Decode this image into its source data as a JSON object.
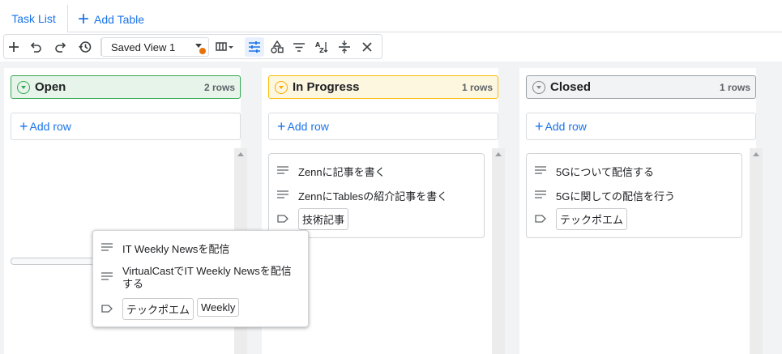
{
  "tabs": {
    "active": "Task List",
    "add": "Add Table"
  },
  "toolbar": {
    "view": "Saved View 1",
    "accent": "#1a73e8",
    "dot_color": "#e8710a",
    "icons": [
      "plus-icon",
      "undo-icon",
      "redo-icon",
      "history-icon",
      "columns-icon",
      "settings-sliders-icon",
      "shapes-icon",
      "filter-icon",
      "sort-az-icon",
      "collapse-icon",
      "close-icon"
    ]
  },
  "columns": [
    {
      "name": "Open",
      "rows": "2 rows",
      "add_row": "Add row",
      "color": "#34a853"
    },
    {
      "name": "In Progress",
      "rows": "1 rows",
      "add_row": "Add row",
      "color": "#fbbc04",
      "cards": [
        {
          "lines": [
            "Zennに記事を書く",
            "ZennにTablesの紹介記事を書く"
          ],
          "tags": [
            "技術記事"
          ]
        }
      ]
    },
    {
      "name": "Closed",
      "rows": "1 rows",
      "add_row": "Add row",
      "color": "#9aa0a6",
      "cards": [
        {
          "lines": [
            "5Gについて配信する",
            "5Gに関しての配信を行う"
          ],
          "tags": [
            "テックポエム"
          ]
        }
      ]
    }
  ],
  "dragging_card": {
    "lines": [
      "IT Weekly Newsを配信",
      "VirtualCastでIT Weekly Newsを配信する"
    ],
    "tags": [
      "テックポエム",
      "Weekly"
    ]
  }
}
